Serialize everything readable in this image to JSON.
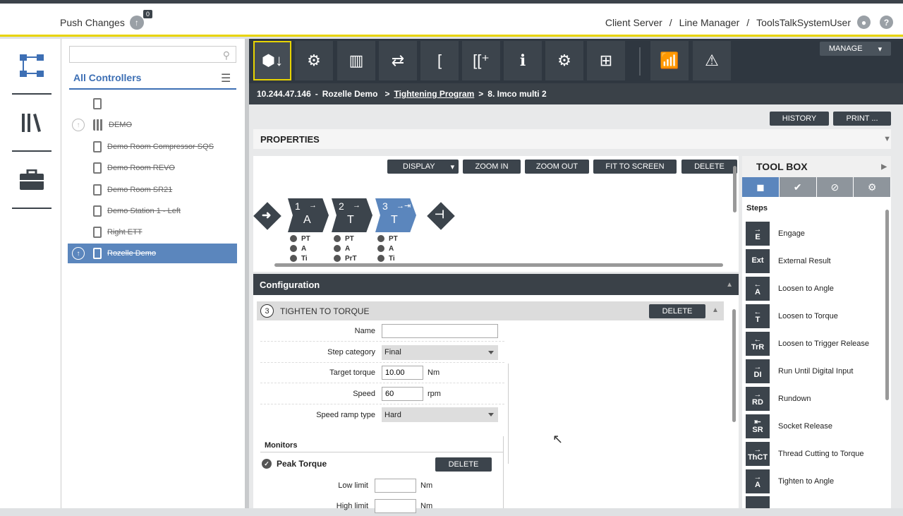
{
  "topbar": {
    "push_label": "Push Changes",
    "push_count": "0",
    "crumbs": [
      "Client Server",
      "Line Manager",
      "ToolsTalkSystemUser"
    ]
  },
  "tree": {
    "search_placeholder": "",
    "all_controllers": "All Controllers",
    "items": [
      {
        "label": ""
      },
      {
        "label": "DEMO"
      },
      {
        "label": "Demo Room Compressor SQS"
      },
      {
        "label": "Demo Room REVO"
      },
      {
        "label": "Demo Room SR21"
      },
      {
        "label": "Demo Station 1 - Left"
      },
      {
        "label": "Right ETT"
      },
      {
        "label": "Rozelle Demo"
      }
    ]
  },
  "toolbar": {
    "manage": "MANAGE",
    "path_ip": "10.244.47.146",
    "path_ctrl": "Rozelle Demo",
    "path_link": "Tightening Program",
    "path_prog": "8. Imco multi 2",
    "history": "HISTORY",
    "print": "PRINT ..."
  },
  "properties": {
    "title": "PROPERTIES"
  },
  "canvas": {
    "display": "DISPLAY",
    "zoom_in": "ZOOM IN",
    "zoom_out": "ZOOM OUT",
    "fit": "FIT TO SCREEN",
    "delete": "DELETE",
    "steps": [
      {
        "num": "1",
        "letter": "A",
        "arrow": "→",
        "mon": [
          "PT",
          "A",
          "Ti"
        ]
      },
      {
        "num": "2",
        "letter": "T",
        "arrow": "→",
        "mon": [
          "PT",
          "A",
          "PrT"
        ]
      },
      {
        "num": "3",
        "letter": "T",
        "arrow": "→⇥",
        "mon": [
          "PT",
          "A",
          "Ti"
        ]
      }
    ]
  },
  "config": {
    "title": "Configuration",
    "step_title": "TIGHTEN TO TORQUE",
    "step_num": "3",
    "delete": "DELETE",
    "fields": {
      "name_label": "Name",
      "name_value": "",
      "category_label": "Step category",
      "category_value": "Final",
      "torque_label": "Target torque",
      "torque_value": "10.00",
      "torque_unit": "Nm",
      "speed_label": "Speed",
      "speed_value": "60",
      "speed_unit": "rpm",
      "ramp_label": "Speed ramp type",
      "ramp_value": "Hard"
    },
    "monitors": "Monitors",
    "peak": "Peak Torque",
    "peak_delete": "DELETE",
    "low_label": "Low limit",
    "low_unit": "Nm",
    "high_label": "High limit",
    "high_unit": "Nm"
  },
  "toolbox": {
    "title": "TOOL BOX",
    "steps_label": "Steps",
    "items": [
      {
        "abbr": "E",
        "name": "Engage"
      },
      {
        "abbr": "Ext",
        "name": "External Result"
      },
      {
        "abbr": "A",
        "name": "Loosen to Angle"
      },
      {
        "abbr": "T",
        "name": "Loosen to Torque"
      },
      {
        "abbr": "TrR",
        "name": "Loosen to Trigger Release"
      },
      {
        "abbr": "DI",
        "name": "Run Until Digital Input"
      },
      {
        "abbr": "RD",
        "name": "Rundown"
      },
      {
        "abbr": "SR",
        "name": "Socket Release"
      },
      {
        "abbr": "ThCT",
        "name": "Thread Cutting to Torque"
      },
      {
        "abbr": "A",
        "name": "Tighten to Angle"
      }
    ]
  }
}
